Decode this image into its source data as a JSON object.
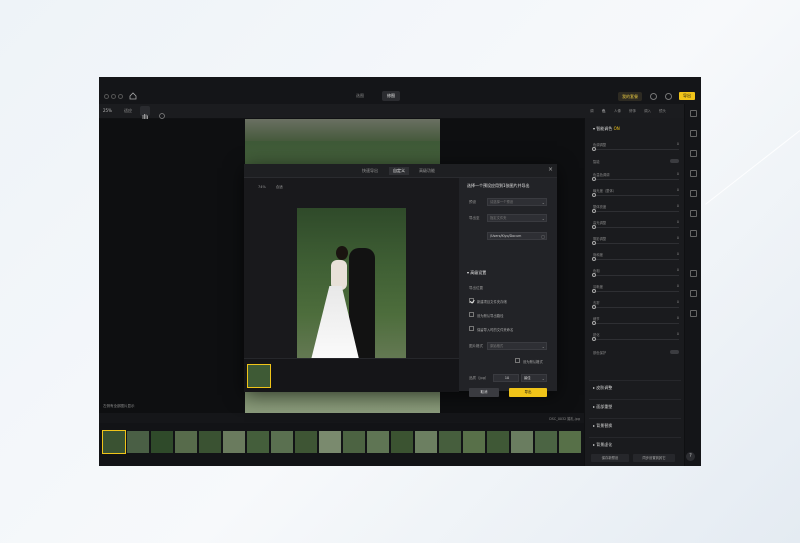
{
  "window": {
    "mode_tabs": [
      "选图",
      "修图"
    ],
    "account_label": "我的套餐",
    "export_label": "导出"
  },
  "toolbar": {
    "zoom": "25%",
    "fit": "适应"
  },
  "canvas": {
    "status": "左侧有全部图片显示"
  },
  "right_tabs": [
    "调",
    "色",
    "人像",
    "修饰",
    "调入",
    "镜头"
  ],
  "panel": {
    "section_title": "智能调色",
    "section_badge": "ON",
    "rows": [
      {
        "label": "色调调整",
        "value": "0"
      },
      {
        "label": "智能",
        "value": ""
      },
      {
        "label": "色温色调调",
        "value": "0"
      },
      {
        "label": "曝光度（整体）",
        "value": "0"
      },
      {
        "label": "整体亮度",
        "value": "0"
      },
      {
        "label": "高光调整",
        "value": "0"
      },
      {
        "label": "阴影调整",
        "value": "0"
      },
      {
        "label": "饱和度",
        "value": "0"
      },
      {
        "label": "色相",
        "value": "0"
      },
      {
        "label": "清晰度",
        "value": "0"
      },
      {
        "label": "去雾",
        "value": "0"
      },
      {
        "label": "细节",
        "value": "0"
      },
      {
        "label": "锐化",
        "value": "0"
      }
    ],
    "skin_protect": "肤色保护",
    "groups": [
      "皮肤调整",
      "面部重塑",
      "背景替换",
      "背景虚化"
    ],
    "save_preset": "保存新预设",
    "copy_settings": "同步设置到其它"
  },
  "filmbar": {
    "filename": "DSC_0032 婚礼.jpg"
  },
  "dialog": {
    "tabs": [
      "快速导出",
      "自定义",
      "高级功能"
    ],
    "zoom": "74%",
    "fit": "合适",
    "title": "选择一个预设应用到1张图片并导出",
    "preset_label": "预设",
    "preset_placeholder": "请选择一个预设",
    "export_label": "导出至",
    "export_value": "指定文件夹",
    "path": "/Users/Kiyo/Docum",
    "advanced_title": "高级设置",
    "location_label": "导出位置",
    "checks": [
      {
        "label": "新建项目文件夹存储",
        "on": true
      },
      {
        "label": "设为默认导出路径",
        "on": false
      },
      {
        "label": "保留导入时的文件夹命名",
        "on": false
      }
    ],
    "format_label": "图片格式",
    "format_value": "原始格式",
    "format_default": "设为默认格式",
    "quality_label": "品质（jpg）",
    "quality_value": "10",
    "quality_unit": "最佳",
    "cancel": "取消",
    "confirm": "导出"
  }
}
